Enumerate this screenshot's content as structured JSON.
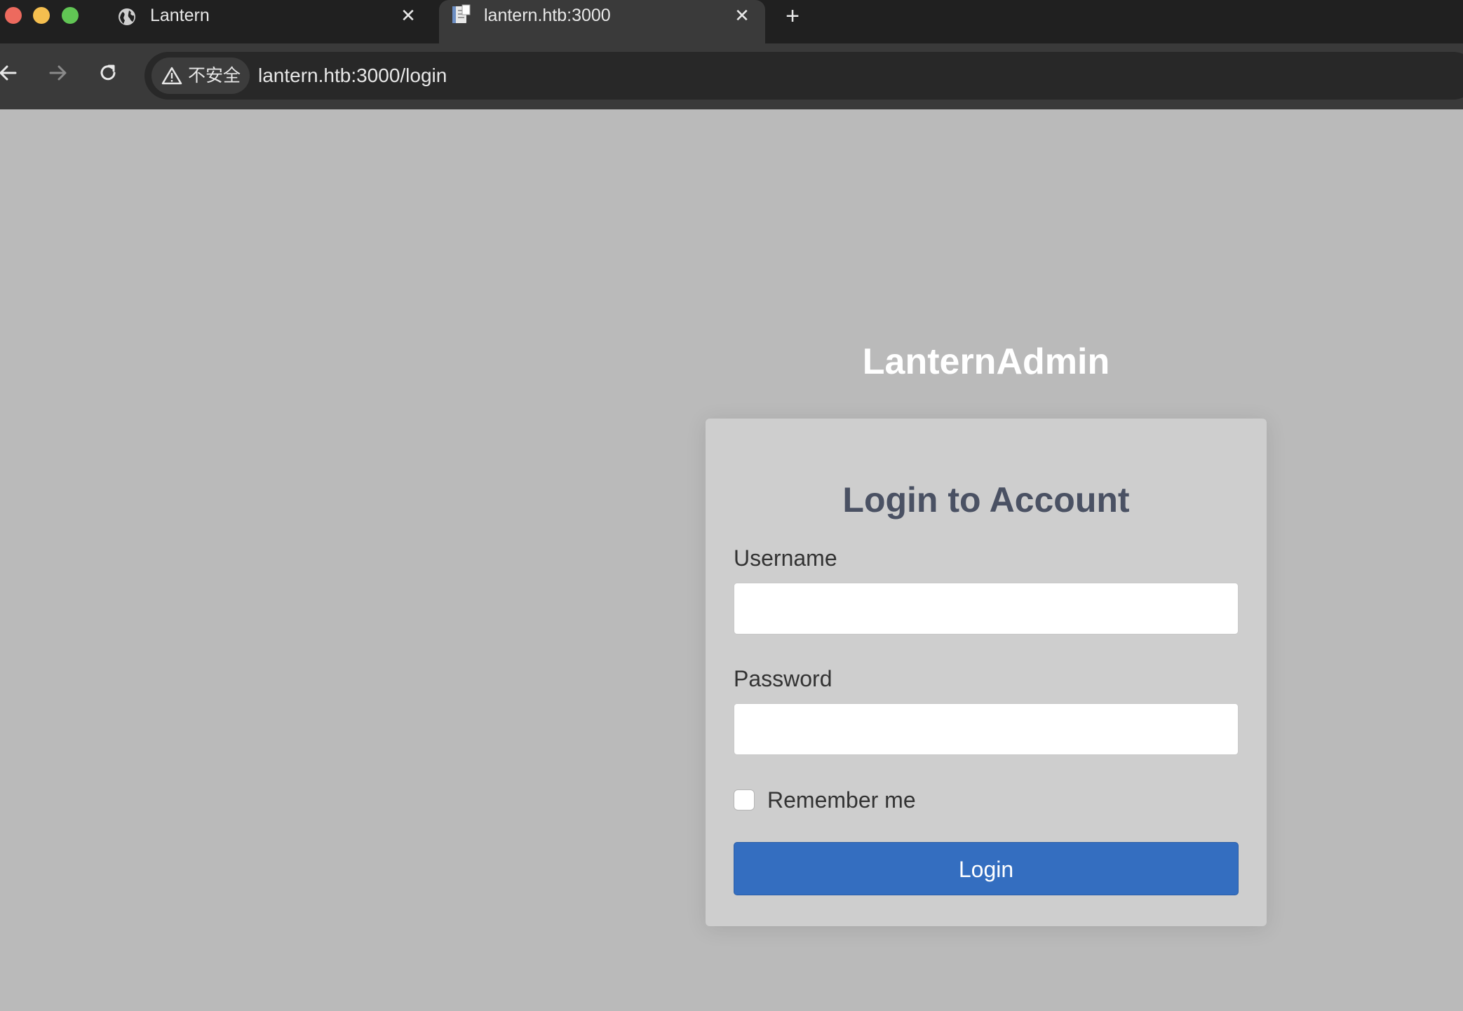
{
  "browser": {
    "tabs": [
      {
        "title": "Lantern",
        "icon": "globe-icon",
        "active": false
      },
      {
        "title": "lantern.htb:3000",
        "icon": "document-icon",
        "active": true
      }
    ],
    "close_glyph": "✕",
    "new_tab_glyph": "+",
    "security_label": "不安全",
    "url": "lantern.htb:3000/login"
  },
  "page": {
    "brand": "LanternAdmin",
    "card": {
      "title": "Login to Account",
      "username_label": "Username",
      "username_value": "",
      "password_label": "Password",
      "password_value": "",
      "remember_label": "Remember me",
      "remember_checked": false,
      "login_label": "Login"
    }
  },
  "colors": {
    "tabstrip_bg": "#202020",
    "toolbar_bg": "#3a3a3a",
    "page_bg": "#bababa",
    "card_bg": "#cecece",
    "title_text": "#4a5163",
    "button_primary": "#346ec0",
    "traffic_red": "#ed6a5e",
    "traffic_yellow": "#f5bf4f",
    "traffic_green": "#61c554"
  }
}
